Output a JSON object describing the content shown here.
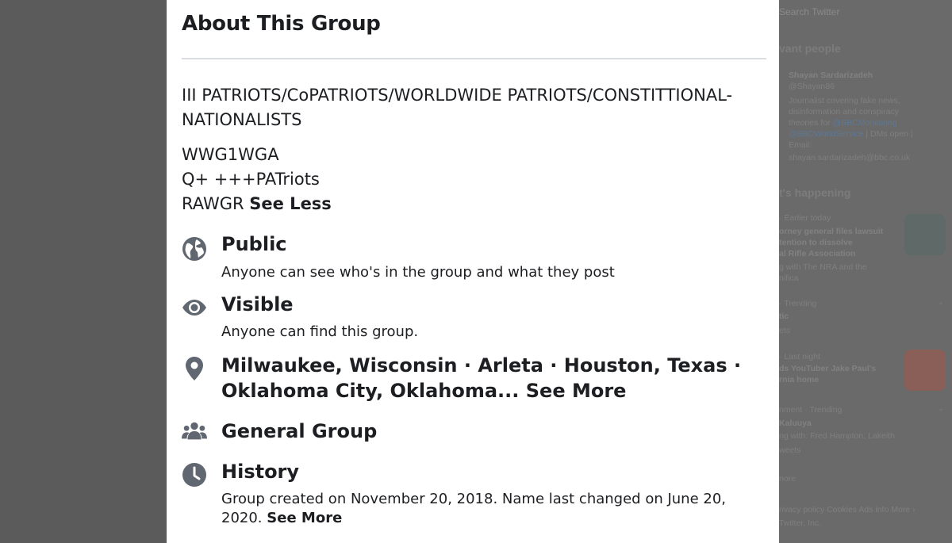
{
  "background": {
    "search_placeholder": "Search Twitter",
    "relevant_heading": "vant people",
    "person": {
      "name": "Shayan Sardarizadeh",
      "handle": "@Shayan86",
      "bio_1": "Journalist covering fake news,",
      "bio_2": "disinformation and conspiracy",
      "bio_3_pre": "theories for ",
      "bio_3_link": "@BBCMonitoring",
      "bio_4_link": "@BBCWorldService",
      "bio_4_post": " | DMs open |",
      "bio_5": "Email:",
      "bio_6": "shayan.sardarizadeh@bbc.co.uk"
    },
    "happening_heading": "t's happening",
    "news1": {
      "meta": "· Earlier today",
      "headline_1": "orney general files lawsuit",
      "headline_2": "tention to dissolve",
      "headline_3": "al Rifle Association",
      "sub_1": "g with The NRA and the",
      "sub_2": "nifica"
    },
    "trend1": {
      "meta": "· Trending",
      "name": "tic",
      "count": "ets"
    },
    "news2": {
      "meta": "· Last night",
      "headline_1": "ds YouTuber Jake Paul's",
      "headline_2": "rnia home"
    },
    "trend2": {
      "meta": "nment · Trending",
      "name": "Kaluuya",
      "sub": "ng with: Fred Hampton, Lakeith",
      "count": "weets"
    },
    "show_more": "nore",
    "footer_1": "rivacy policy  Cookies  Ads info  More ›",
    "footer_2": "Twitter, Inc.",
    "colors": {
      "thumb1": "#5f6a68",
      "thumb2": "#8a5f58"
    }
  },
  "modal": {
    "title": "About This Group",
    "description": {
      "line1": "III PATRIOTS/CoPATRIOTS/WORLDWIDE PATRIOTS/CONSTITTIONAL-NATIONALISTS",
      "line2": "WWG1WGA",
      "line3": "Q+ +++PATriots",
      "line4_pre": "RAWGR ",
      "see_less": "See Less"
    },
    "privacy": {
      "icon": "globe-icon",
      "heading": "Public",
      "detail": "Anyone can see who's in the group and what they post"
    },
    "visibility": {
      "icon": "eye-icon",
      "heading": "Visible",
      "detail": "Anyone can find this group."
    },
    "location": {
      "icon": "location-pin-icon",
      "line1": "Milwaukee, Wisconsin · Arleta · Houston, Texas ·",
      "line2": "Oklahoma City, Oklahoma... ",
      "see_more": "See More"
    },
    "group_type": {
      "icon": "people-icon",
      "heading": "General Group"
    },
    "history": {
      "icon": "clock-icon",
      "heading": "History",
      "detail_1": "Group created on November 20, 2018. Name last changed on June 20,",
      "detail_2": "2020.  ",
      "see_more": "See More"
    },
    "colors": {
      "icon": "#606770",
      "text": "#1c1e21",
      "divider": "#dadde1"
    }
  }
}
